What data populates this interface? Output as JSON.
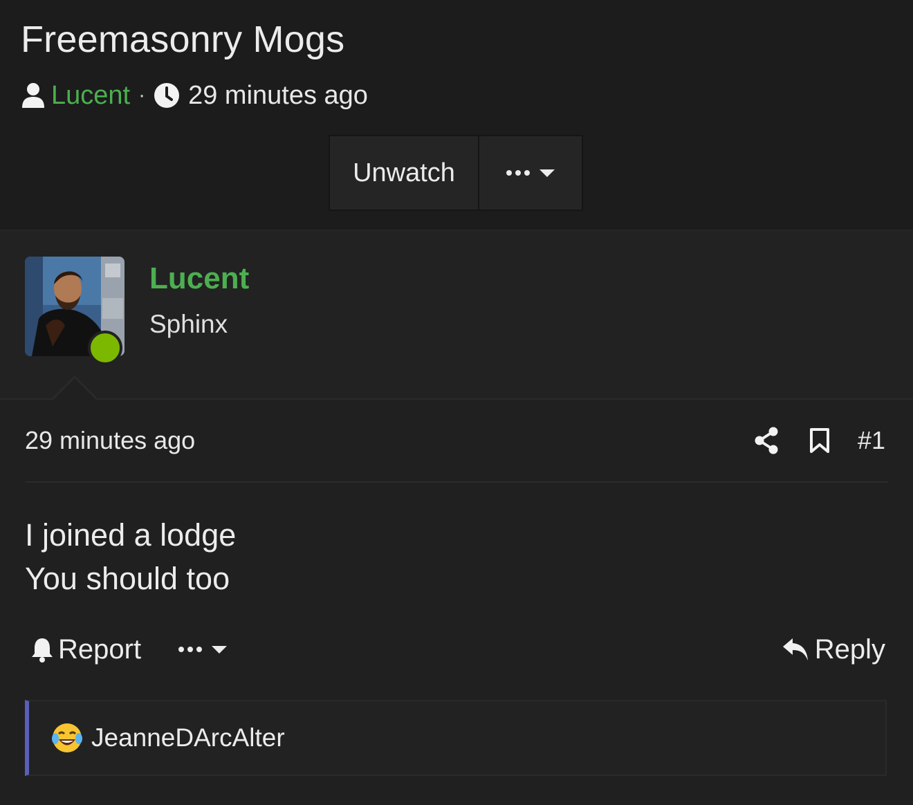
{
  "thread": {
    "title": "Freemasonry Mogs",
    "author": "Lucent",
    "separator": "·",
    "time": "29 minutes ago"
  },
  "buttons": {
    "unwatch_label": "Unwatch"
  },
  "user": {
    "name": "Lucent",
    "title": "Sphinx",
    "online_color": "#7cb800",
    "name_color": "#4caf50"
  },
  "post": {
    "time": "29 minutes ago",
    "number": "#1",
    "body_lines": [
      "I joined a lodge",
      "You should too"
    ],
    "report_label": "Report",
    "reply_label": "Reply"
  },
  "reactions": {
    "emoji": "joy-tears-emoji",
    "user": "JeanneDArcAlter",
    "accent_color": "#5a5fb8"
  },
  "icons": [
    "user-icon",
    "clock-icon",
    "more-dots-icon",
    "caret-down-icon",
    "share-icon",
    "bookmark-icon",
    "bell-icon",
    "reply-icon"
  ]
}
